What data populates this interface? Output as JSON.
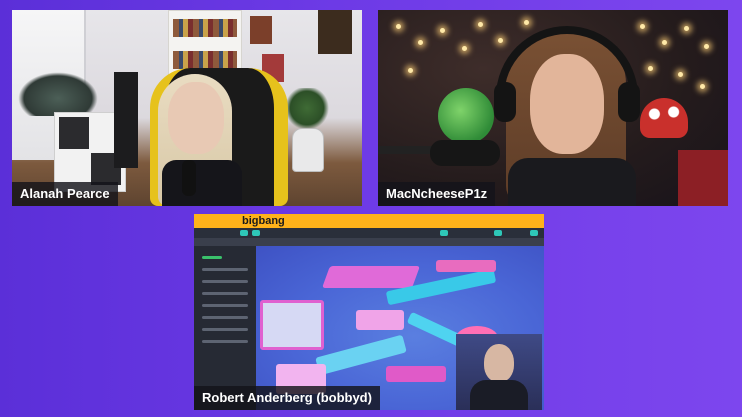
{
  "participants": [
    {
      "name": "Alanah Pearce"
    },
    {
      "name": "MacNcheeseP1z"
    },
    {
      "name": "Robert Anderberg (bobbyd)"
    }
  ],
  "shared_screen": {
    "brand": "bigbang",
    "icon": "play-icon"
  },
  "colors": {
    "background_start": "#5b2fd8",
    "background_end": "#7d46ee",
    "nameplate_bg": "#14141a",
    "brand_bar": "#ffb21a",
    "accent": "#2ec7b8"
  }
}
